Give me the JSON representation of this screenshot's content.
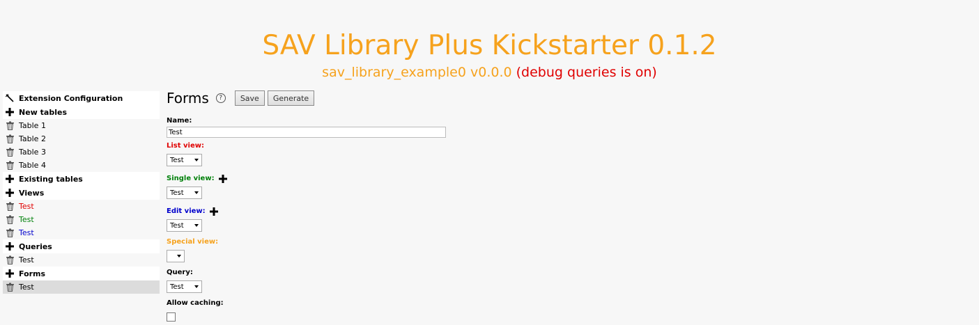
{
  "header": {
    "title": "SAV Library Plus Kickstarter 0.1.2",
    "extension": "sav_library_example0 v0.0.0",
    "debug": "(debug queries is on)"
  },
  "colors": {
    "accent": "#f6a21d",
    "debug": "#e00000",
    "list_view": "#e00000",
    "single_view": "#00800a",
    "edit_view": "#0000cc",
    "special_view": "#f6a21d"
  },
  "sidebar": {
    "extension_config": "Extension Configuration",
    "new_tables": "New tables",
    "tables": [
      "Table 1",
      "Table 2",
      "Table 3",
      "Table 4"
    ],
    "existing_tables": "Existing tables",
    "views": "Views",
    "view_items": [
      "Test",
      "Test",
      "Test"
    ],
    "queries": "Queries",
    "query_items": [
      "Test"
    ],
    "forms": "Forms",
    "form_items": [
      "Test"
    ]
  },
  "main": {
    "title": "Forms",
    "help": "?",
    "save": "Save",
    "generate": "Generate",
    "name_label": "Name:",
    "name_value": "Test",
    "list_view_label": "List view:",
    "list_view_value": "Test",
    "single_view_label": "Single view:",
    "single_view_value": "Test",
    "edit_view_label": "Edit view:",
    "edit_view_value": "Test",
    "special_view_label": "Special view:",
    "special_view_value": "",
    "query_label": "Query:",
    "query_value": "Test",
    "allow_caching_label": "Allow caching:",
    "allow_caching_checked": false
  }
}
